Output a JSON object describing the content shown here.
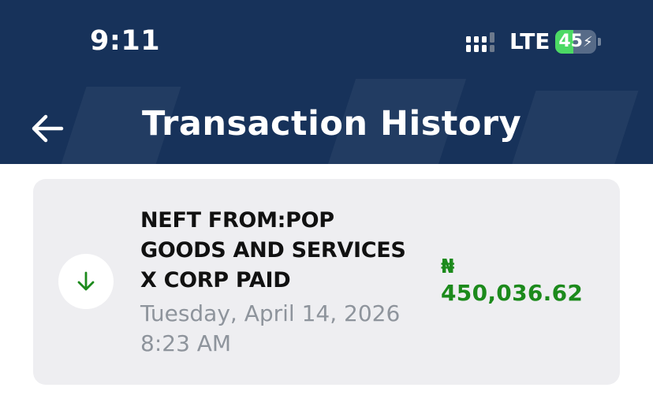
{
  "status_bar": {
    "time": "9:11",
    "network": "LTE",
    "battery_level": "45",
    "battery_percent": 45
  },
  "header": {
    "title": "Transaction History",
    "back_icon": "arrow-left-icon",
    "background_color": "#17325a"
  },
  "transactions": [
    {
      "description_lines": [
        "NEFT FROM:POP",
        "GOODS AND SERVICES",
        "X CORP PAID"
      ],
      "date": "Tuesday, April 14, 2026",
      "time": "8:23 AM",
      "currency_symbol": "₦",
      "amount": "450,036.62",
      "direction_icon": "arrow-down-icon",
      "amount_color": "#1c8a1c"
    }
  ]
}
